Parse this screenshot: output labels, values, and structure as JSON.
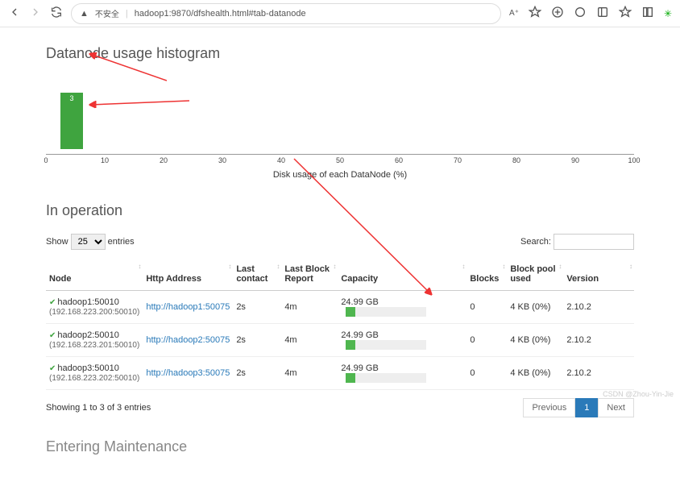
{
  "browser": {
    "warn": "不安全",
    "url": "hadoop1:9870/dfshealth.html#tab-datanode"
  },
  "titles": {
    "histogram": "Datanode usage histogram",
    "inOperation": "In operation",
    "maintenance": "Entering Maintenance"
  },
  "show": {
    "prefix": "Show",
    "value": "25",
    "suffix": "entries"
  },
  "search": {
    "label": "Search:"
  },
  "columns": {
    "node": "Node",
    "http": "Http Address",
    "contact": "Last contact",
    "report": "Last Block Report",
    "capacity": "Capacity",
    "blocks": "Blocks",
    "pool": "Block pool used",
    "version": "Version"
  },
  "rows": [
    {
      "name": "hadoop1:50010",
      "ip": "(192.168.223.200:50010)",
      "http": "http://hadoop1:50075",
      "contact": "2s",
      "report": "4m",
      "capacity": "24.99 GB",
      "used_pct": 12,
      "blocks": "0",
      "pool": "4 KB (0%)",
      "version": "2.10.2"
    },
    {
      "name": "hadoop2:50010",
      "ip": "(192.168.223.201:50010)",
      "http": "http://hadoop2:50075",
      "contact": "2s",
      "report": "4m",
      "capacity": "24.99 GB",
      "used_pct": 12,
      "blocks": "0",
      "pool": "4 KB (0%)",
      "version": "2.10.2"
    },
    {
      "name": "hadoop3:50010",
      "ip": "(192.168.223.202:50010)",
      "http": "http://hadoop3:50075",
      "contact": "2s",
      "report": "4m",
      "capacity": "24.99 GB",
      "used_pct": 12,
      "blocks": "0",
      "pool": "4 KB (0%)",
      "version": "2.10.2"
    }
  ],
  "pager": {
    "info": "Showing 1 to 3 of 3 entries",
    "prev": "Previous",
    "page": "1",
    "next": "Next"
  },
  "watermark": "CSDN @Zhou-Yin-Jie",
  "chart_data": {
    "type": "bar",
    "title": "Datanode usage histogram",
    "xlabel": "Disk usage of each DataNode (%)",
    "xlim": [
      0,
      100
    ],
    "x_ticks": [
      0,
      10,
      20,
      30,
      40,
      50,
      60,
      70,
      80,
      90,
      100
    ],
    "bar_label": "3",
    "categories": [
      0
    ],
    "values": [
      3
    ]
  }
}
